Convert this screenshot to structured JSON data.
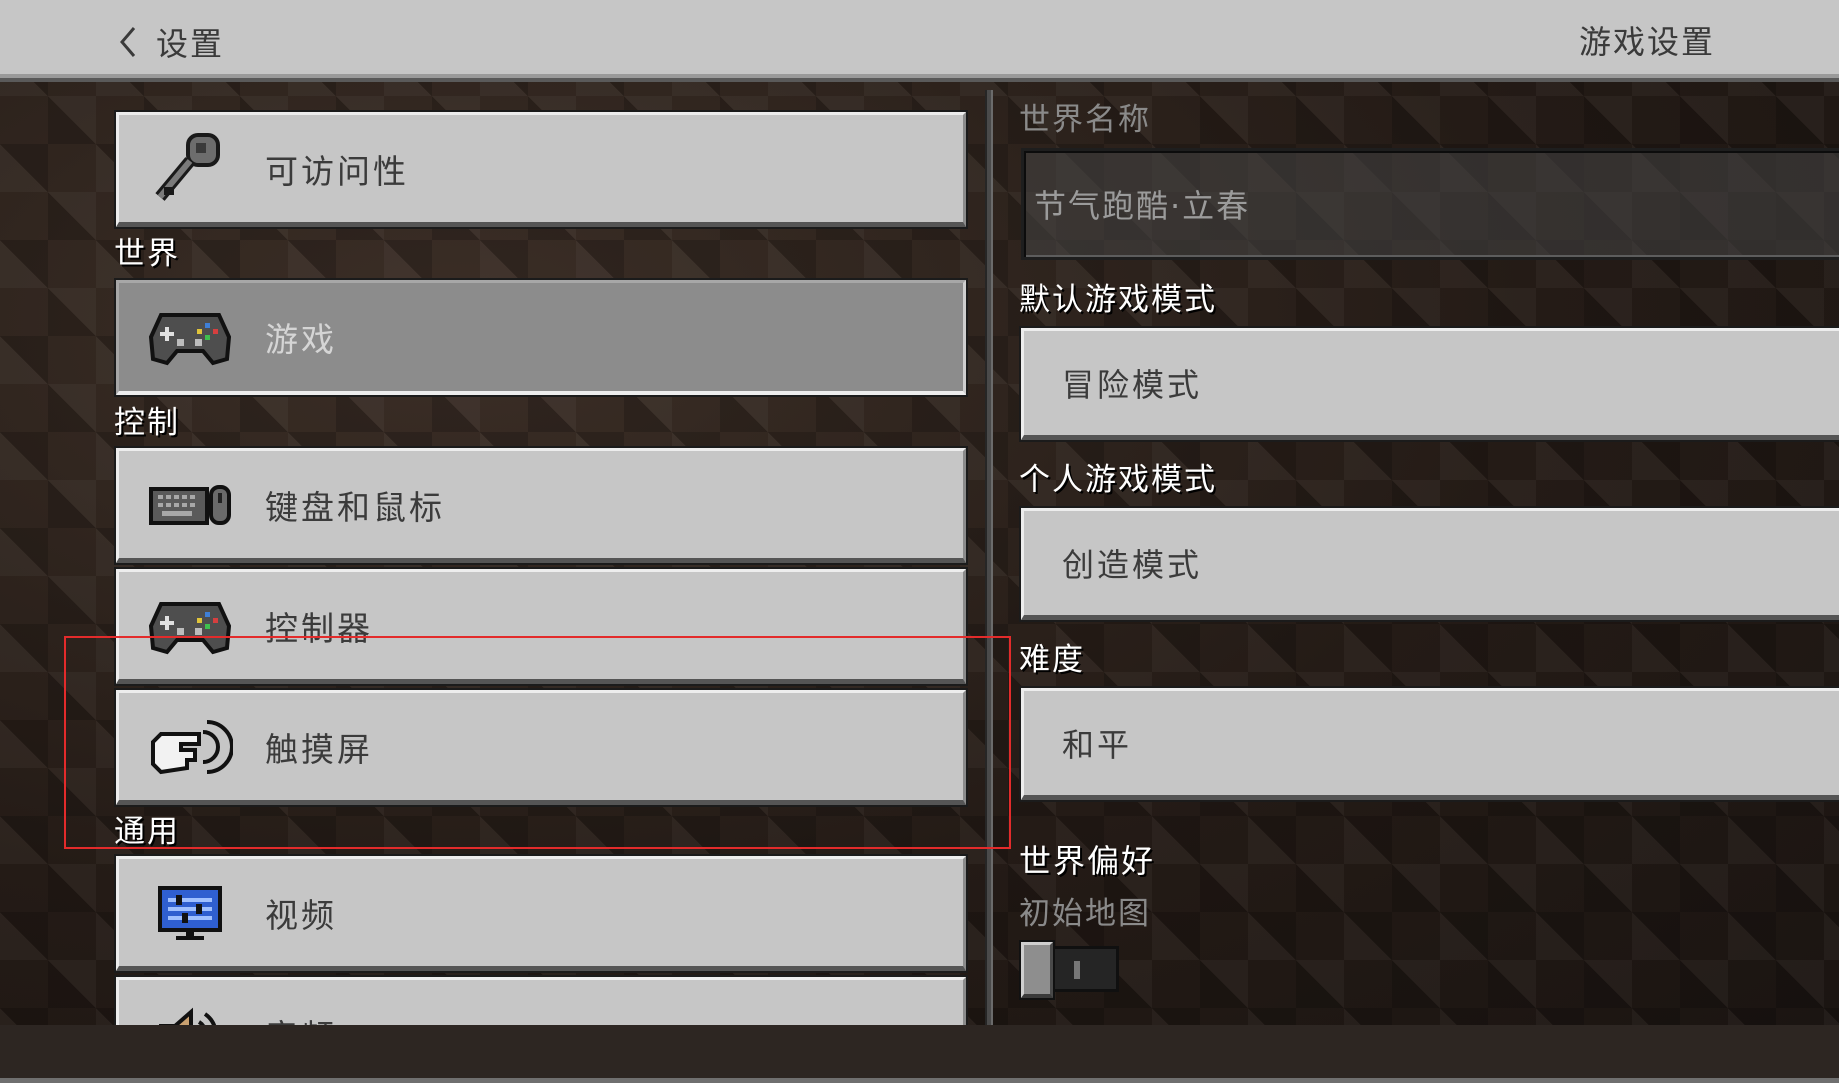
{
  "header": {
    "back_label": "设置",
    "title": "游戏设置"
  },
  "sidebar": {
    "sections": {
      "world": "世界",
      "controls": "控制",
      "general": "通用"
    },
    "items": [
      {
        "label": "可访问性",
        "icon": "key-icon"
      },
      {
        "label": "游戏",
        "icon": "gamepad-icon",
        "selected": true
      },
      {
        "label": "键盘和鼠标",
        "icon": "keyboard-mouse-icon"
      },
      {
        "label": "控制器",
        "icon": "controller-icon"
      },
      {
        "label": "触摸屏",
        "icon": "touch-hand-icon"
      },
      {
        "label": "视频",
        "icon": "monitor-icon"
      },
      {
        "label": "音频",
        "icon": "speaker-icon"
      }
    ]
  },
  "main": {
    "world_name_label": "世界名称",
    "world_name_value": "节气跑酷·立春",
    "default_mode_label": "默认游戏模式",
    "default_mode_value": "冒险模式",
    "personal_mode_label": "个人游戏模式",
    "personal_mode_value": "创造模式",
    "difficulty_label": "难度",
    "difficulty_value": "和平",
    "world_prefs_heading": "世界偏好",
    "starting_map_label": "初始地图",
    "starting_map_on": false
  },
  "colors": {
    "button_bg": "#c6c6c6",
    "selected_bg": "#8c8c8c",
    "highlight": "#e32b2b"
  }
}
